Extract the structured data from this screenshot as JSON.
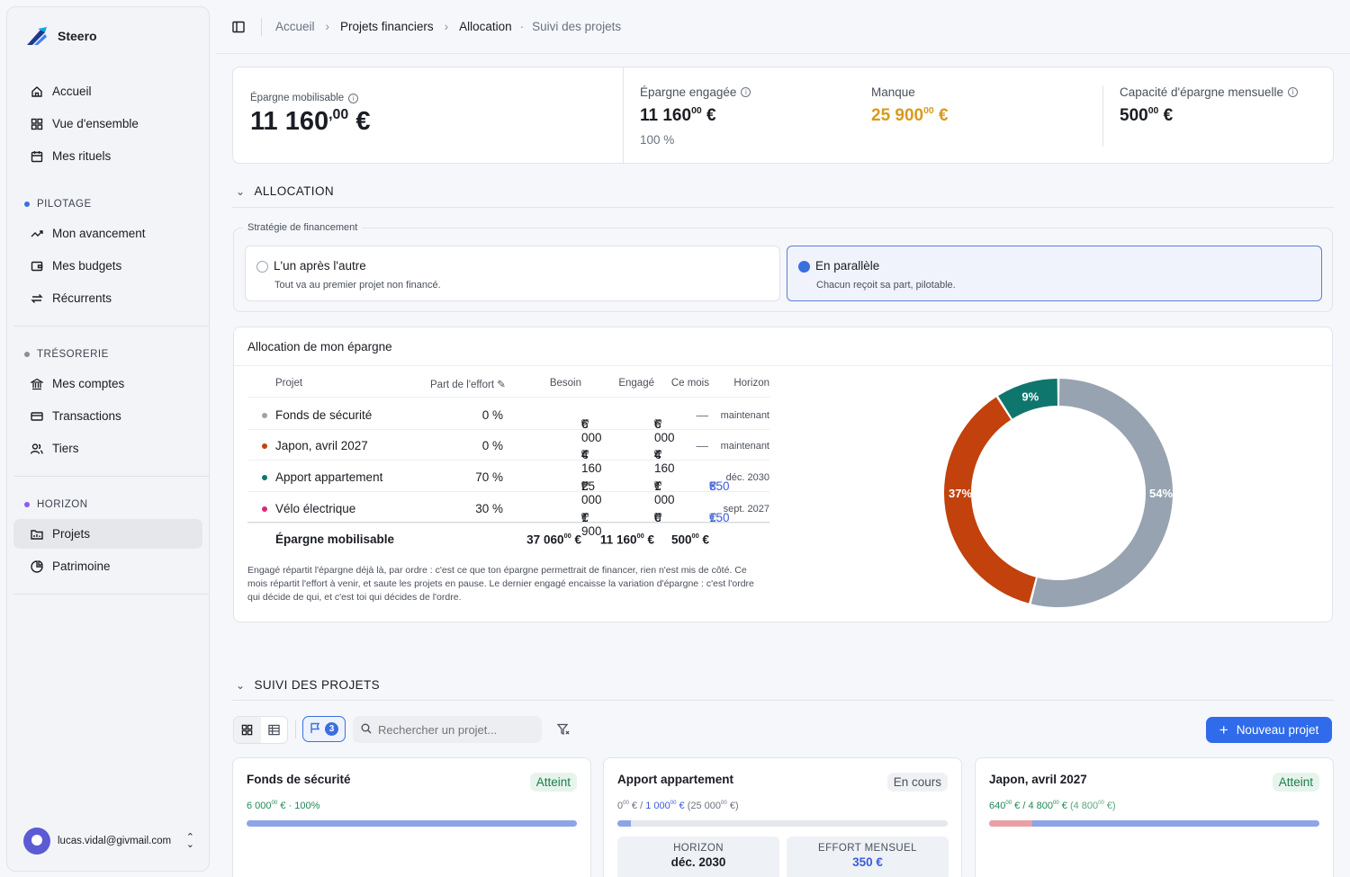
{
  "app": {
    "name": "Steero"
  },
  "sidebar": {
    "main": [
      {
        "label": "Accueil",
        "icon": "home-icon"
      },
      {
        "label": "Vue d'ensemble",
        "icon": "grid-icon"
      },
      {
        "label": "Mes rituels",
        "icon": "calendar-icon"
      }
    ],
    "sections": [
      {
        "title": "PILOTAGE",
        "color": "#3b6fe0",
        "items": [
          {
            "label": "Mon avancement",
            "icon": "trend-icon"
          },
          {
            "label": "Mes budgets",
            "icon": "wallet-icon"
          },
          {
            "label": "Récurrents",
            "icon": "repeat-icon"
          }
        ]
      },
      {
        "title": "TRÉSORERIE",
        "color": "#8a8f99",
        "items": [
          {
            "label": "Mes comptes",
            "icon": "bank-icon"
          },
          {
            "label": "Transactions",
            "icon": "card-icon"
          },
          {
            "label": "Tiers",
            "icon": "users-icon"
          }
        ]
      },
      {
        "title": "HORIZON",
        "color": "#8b5cf6",
        "items": [
          {
            "label": "Projets",
            "icon": "folder-icon",
            "active": true
          },
          {
            "label": "Patrimoine",
            "icon": "pie-icon"
          }
        ]
      }
    ],
    "user_email": "lucas.vidal@givmail.com"
  },
  "breadcrumb": {
    "items": [
      "Accueil",
      "Projets financiers",
      "Allocation"
    ],
    "sub": "Suivi des projets"
  },
  "kpis": {
    "mobilisable": {
      "label": "Épargne mobilisable",
      "int": "11 160",
      "dec": "00",
      "cur": "€"
    },
    "engagee": {
      "label": "Épargne engagée",
      "int": "11 160",
      "dec": "00",
      "cur": "€",
      "pct": "100 %"
    },
    "manque": {
      "label": "Manque",
      "int": "25 900",
      "dec": "00",
      "cur": "€"
    },
    "capacite": {
      "label": "Capacité d'épargne mensuelle",
      "int": "500",
      "dec": "00",
      "cur": "€"
    }
  },
  "allocation": {
    "section_title": "ALLOCATION",
    "strategy_legend": "Stratégie de financement",
    "options": [
      {
        "title": "L'un après l'autre",
        "desc": "Tout va au premier projet non financé.",
        "selected": false
      },
      {
        "title": "En parallèle",
        "desc": "Chacun reçoit sa part, pilotable.",
        "selected": true
      }
    ],
    "card_title": "Allocation de mon épargne",
    "headers": [
      "Projet",
      "Part de l'effort",
      "Besoin",
      "Engagé",
      "Ce mois",
      "Horizon"
    ],
    "rows": [
      {
        "name": "Fonds de sécurité",
        "color": "#9aa3ae",
        "part": "0 %",
        "besoin": "6 000",
        "engage": "6 000",
        "mois": "—",
        "horizon": "maintenant"
      },
      {
        "name": "Japon, avril 2027",
        "color": "#c2410c",
        "part": "0 %",
        "besoin": "4 160",
        "engage": "4 160",
        "mois": "—",
        "horizon": "maintenant"
      },
      {
        "name": "Apport appartement",
        "color": "#0f766e",
        "part": "70 %",
        "besoin": "25 000",
        "engage": "1 000",
        "mois": "350",
        "horizon": "déc. 2030"
      },
      {
        "name": "Vélo électrique",
        "color": "#db2777",
        "part": "30 %",
        "besoin": "1 900",
        "engage": "0",
        "mois": "150",
        "horizon": "sept. 2027"
      }
    ],
    "total": {
      "label": "Épargne mobilisable",
      "besoin": "37 060",
      "engage": "11 160",
      "mois": "500"
    },
    "dec": "00",
    "cur": "€",
    "note": "Engagé répartit l'épargne déjà là, par ordre : c'est ce que ton épargne permettrait de financer, rien n'est mis de côté. Ce mois répartit l'effort à venir, et saute les projets en pause. Le dernier engagé encaisse la variation d'épargne : c'est l'ordre qui décide de qui, et c'est toi qui décides de l'ordre."
  },
  "chart_data": {
    "type": "pie",
    "donut": true,
    "slices": [
      {
        "label": "54%",
        "value": 54,
        "color": "#97a3b1"
      },
      {
        "label": "37%",
        "value": 37,
        "color": "#c2410c"
      },
      {
        "label": "9%",
        "value": 9,
        "color": "#0f766e"
      }
    ]
  },
  "suivi": {
    "section_title": "SUIVI DES PROJETS",
    "flag_count": "3",
    "search_placeholder": "Rechercher un projet...",
    "new_button": "Nouveau projet",
    "cards": [
      {
        "title": "Fonds de sécurité",
        "status": "Atteint",
        "amount": "6 000",
        "dec": "00",
        "suffix": "€ · 100%",
        "progress": 1.0
      },
      {
        "title": "Apport appartement",
        "status": "En cours",
        "a": "0",
        "b": "1 000",
        "c": "25 000",
        "progress": 0.04,
        "horizon_label": "HORIZON",
        "horizon_val": "déc. 2030",
        "effort_label": "EFFORT MENSUEL",
        "effort_val": "350 €"
      },
      {
        "title": "Japon, avril 2027",
        "status": "Atteint",
        "a": "640",
        "b": "4 800",
        "c": "4 800",
        "progress": 0.13
      }
    ]
  }
}
